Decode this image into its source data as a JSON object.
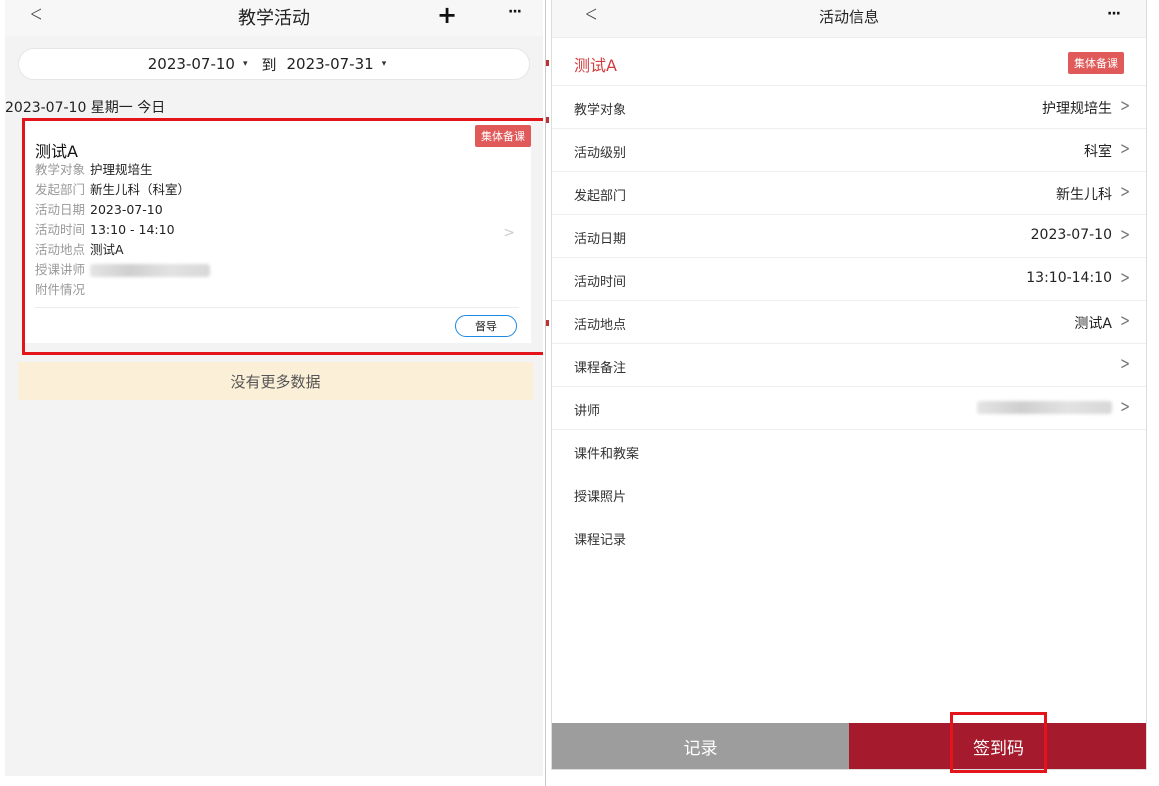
{
  "left": {
    "nav": {
      "back": "<",
      "title": "教学活动",
      "plus": "+",
      "more": "···"
    },
    "date_range": {
      "start": "2023-07-10",
      "start_caret": "▾",
      "to": "到",
      "end": "2023-07-31",
      "end_caret": "▾"
    },
    "day_header": "2023-07-10 星期一 今日",
    "card": {
      "tag": "集体备课",
      "name": "测试A",
      "rows": [
        {
          "label": "教学对象",
          "value": "护理规培生"
        },
        {
          "label": "发起部门",
          "value": "新生儿科（科室）"
        },
        {
          "label": "活动日期",
          "value": "2023-07-10"
        },
        {
          "label": "活动时间",
          "value": "13:10 - 14:10"
        },
        {
          "label": "活动地点",
          "value": "测试A"
        },
        {
          "label": "授课讲师",
          "value": ""
        },
        {
          "label": "附件情况",
          "value": ""
        }
      ],
      "chevron": ">",
      "action_button": "督导"
    },
    "no_more": "没有更多数据"
  },
  "right": {
    "nav": {
      "back": "<",
      "title": "活动信息",
      "more": "···"
    },
    "header": {
      "name": "测试A",
      "tag": "集体备课"
    },
    "items": [
      {
        "label": "教学对象",
        "value": "护理规培生",
        "arrow": ">"
      },
      {
        "label": "活动级别",
        "value": "科室",
        "arrow": ">"
      },
      {
        "label": "发起部门",
        "value": "新生儿科",
        "arrow": ">"
      },
      {
        "label": "活动日期",
        "value": "2023-07-10",
        "arrow": ">"
      },
      {
        "label": "活动时间",
        "value": "13:10-14:10",
        "arrow": ">"
      },
      {
        "label": "活动地点",
        "value": "测试A",
        "arrow": ">"
      },
      {
        "label": "课程备注",
        "value": "",
        "arrow": ">"
      },
      {
        "label": "讲师",
        "value": "",
        "arrow": ">"
      },
      {
        "label": "课件和教案"
      },
      {
        "label": "授课照片"
      },
      {
        "label": "课程记录"
      }
    ],
    "bottom": {
      "record": "记录",
      "sign_code": "签到码"
    }
  },
  "colors": {
    "tag_red": "#e05a5a",
    "title_red": "#d23c3c",
    "sign_btn": "#a51a2c",
    "record_btn": "#9d9d9d",
    "highlight_box": "#e3151b",
    "no_more_bg": "#fbefd8"
  }
}
